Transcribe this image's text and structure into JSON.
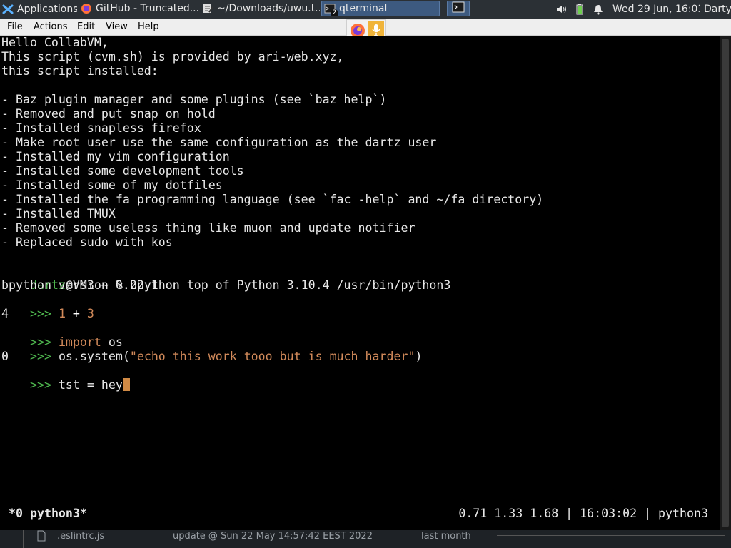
{
  "panel": {
    "applications_label": "Applications",
    "tasks": [
      {
        "label": "GitHub - Truncated..."
      },
      {
        "label": "~/Downloads/uwu.t..."
      },
      {
        "label": "qterminal",
        "badge": "2"
      }
    ],
    "clock": "Wed 29 Jun, 16:03",
    "user": "Darty",
    "accent": "#3d5a80"
  },
  "menubar": {
    "items": [
      "File",
      "Actions",
      "Edit",
      "View",
      "Help"
    ]
  },
  "terminal": {
    "intro": [
      "Hello CollabVM,",
      "This script (cvm.sh) is provided by ari-web.xyz,",
      "this script installed:",
      "",
      "- Baz plugin manager and some plugins (see `baz help`)",
      "- Removed and put snap on hold",
      "- Installed snapless firefox",
      "- Make root user use the same configuration as the dartz user",
      "- Installed my vim configuration",
      "- Installed some development tools",
      "- Installed some of my dotfiles",
      "- Installed the fa programming language (see `fac -help` and ~/fa directory)",
      "- Installed TMUX",
      "- Removed some useless thing like muon and update notifier",
      "- Replaced sudo with kos"
    ],
    "prompt_user": "dartz",
    "prompt_rest": "@VM3 ~ % bpython",
    "bpython_version": "bpython version 0.22.1 on top of Python 3.10.4 /usr/bin/python3",
    "repl_prompt": ">>> ",
    "expr1_a": "1",
    "expr1_op": " + ",
    "expr1_b": "3",
    "result1": "4",
    "import_kw": "import",
    "import_mod": " os",
    "call_fn": "os.system(",
    "call_str": "\"echo this work tooo but is much harder\"",
    "call_close": ")",
    "result2": "0",
    "current_input": "tst = hey"
  },
  "status": {
    "left": "*0 python3*",
    "right": "0.71 1.33 1.68 | 16:03:02 | python3"
  },
  "bottom_strip": {
    "file": ".eslintrc.js",
    "commit": "update @ Sun 22 May 14:57:42 EEST 2022",
    "age": "last month"
  }
}
